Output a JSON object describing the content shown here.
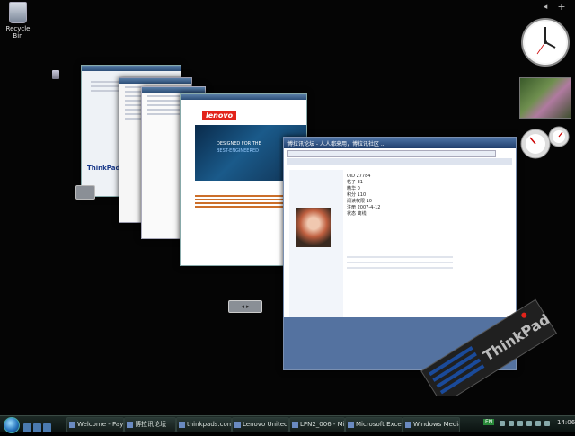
{
  "desktop": {
    "recycle_bin_label": "Recycle Bin"
  },
  "windows": {
    "thinkpad_partial": "ThinkPad",
    "lenovo": {
      "logo": "lenovo",
      "banner_line1": "DESIGNED FOR THE",
      "banner_line2": "BEST-ENGINEERED"
    },
    "forum": {
      "title": "博拉讯论坛 - 人人都来用，博拉讯社区 ...",
      "text_lines": [
        "UID 27784",
        "帖子 31",
        "精华 0",
        "积分 110",
        "阅读权限 10",
        "注册 2007-4-12",
        "状态 离线"
      ]
    }
  },
  "thinkpad_logo_text": "ThinkPad",
  "taskbar": {
    "tasks": [
      {
        "label": "Welcome - Pay..."
      },
      {
        "label": "博拉讯论坛"
      },
      {
        "label": "thinkpads.com..."
      },
      {
        "label": "Lenovo United ..."
      },
      {
        "label": "LPN2_006 - Micr..."
      },
      {
        "label": "Microsoft Excel..."
      },
      {
        "label": "Windows Media..."
      }
    ],
    "tray": {
      "lang": "EN"
    },
    "clock": "14:06"
  }
}
